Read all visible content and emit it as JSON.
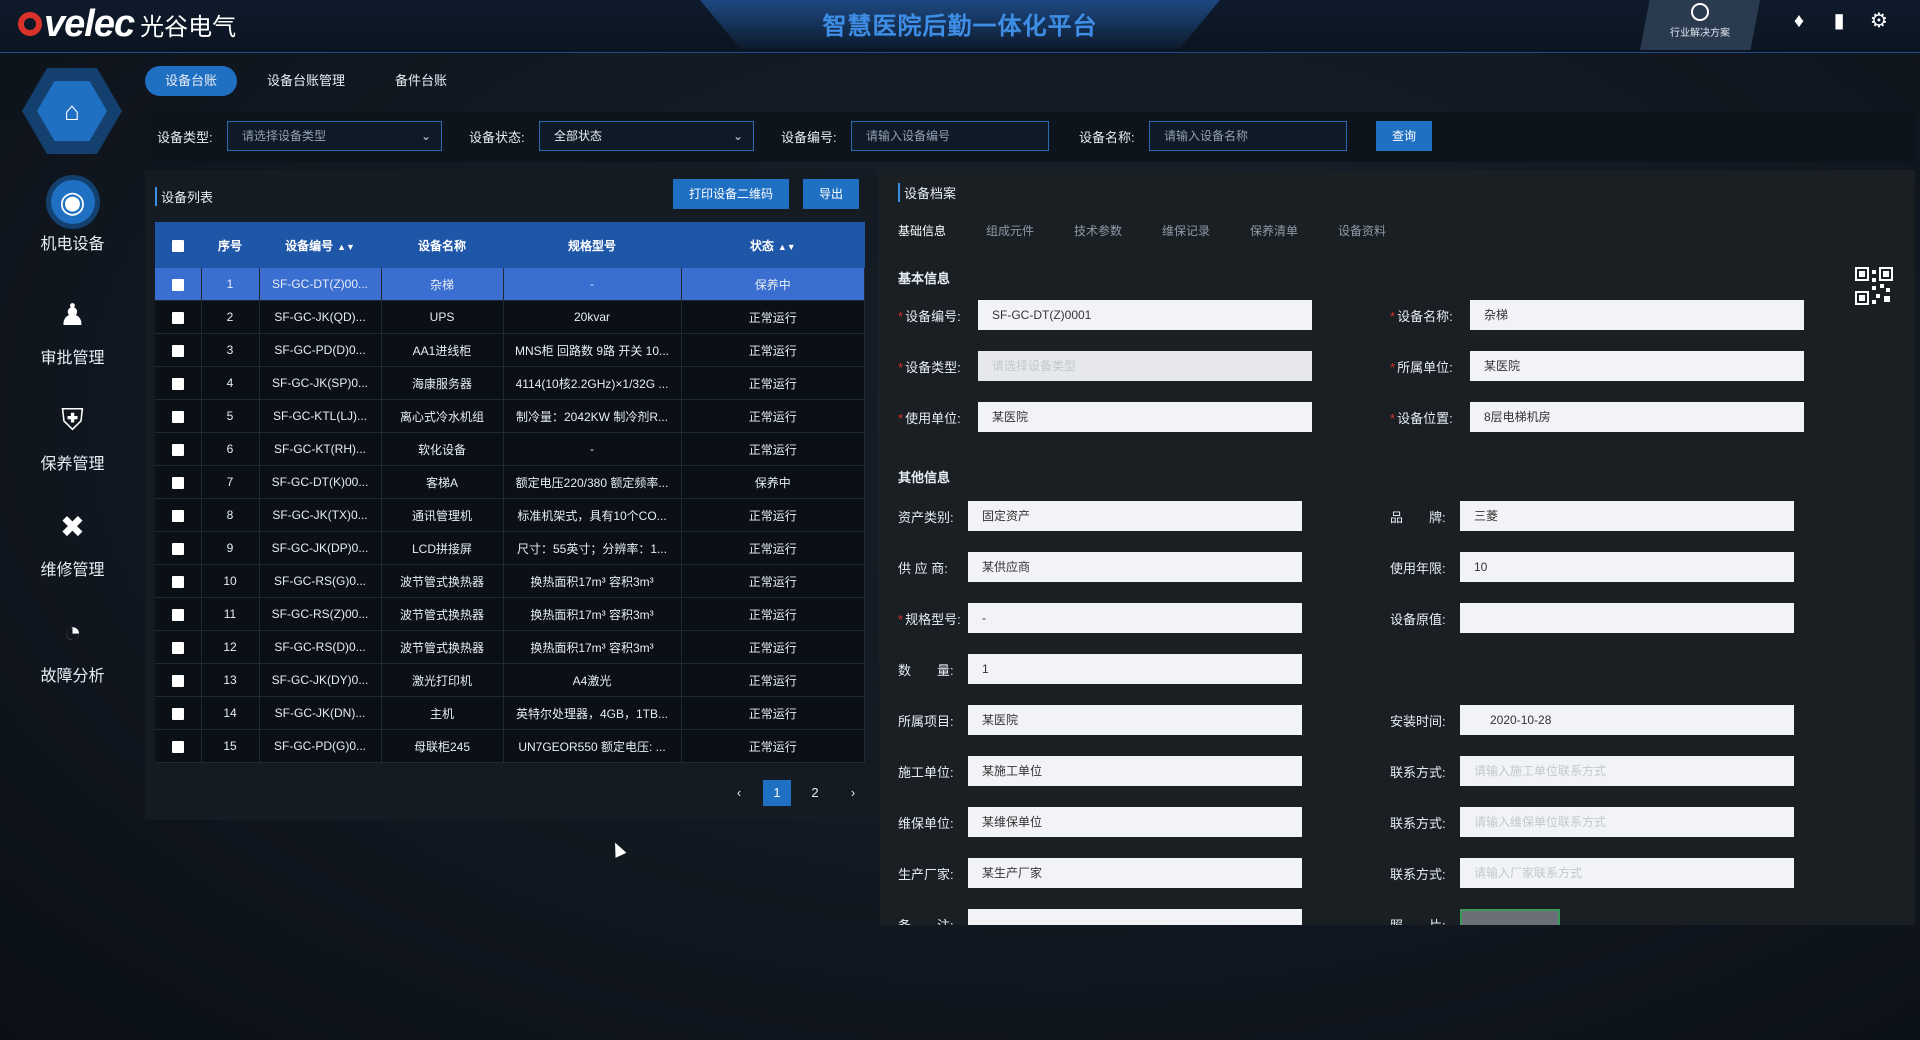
{
  "header": {
    "logo_text": "velec",
    "logo_cn": "光谷电气",
    "title": "智慧医院后勤一体化平台",
    "solution_label": "行业解决方案"
  },
  "icons": {
    "bell": "bell-icon",
    "clipboard": "clipboard-icon",
    "settings": "gear-icon"
  },
  "sidebar": {
    "items": [
      {
        "label": "机电设备",
        "icon": "device-icon"
      },
      {
        "label": "审批管理",
        "icon": "person-stamp-icon"
      },
      {
        "label": "保养管理",
        "icon": "shield-icon"
      },
      {
        "label": "维修管理",
        "icon": "tools-icon"
      },
      {
        "label": "故障分析",
        "icon": "pie-chart-icon"
      }
    ]
  },
  "subtabs": [
    "设备台账",
    "设备台账管理",
    "备件台账"
  ],
  "filters": {
    "type_label": "设备类型:",
    "type_placeholder": "请选择设备类型",
    "status_label": "设备状态:",
    "status_value": "全部状态",
    "code_label": "设备编号:",
    "code_placeholder": "请输入设备编号",
    "name_label": "设备名称:",
    "name_placeholder": "请输入设备名称",
    "query_button": "查询"
  },
  "list": {
    "title": "设备列表",
    "print_button": "打印设备二维码",
    "export_button": "导出",
    "columns": [
      "序号",
      "设备编号",
      "设备名称",
      "规格型号",
      "状态"
    ],
    "rows": [
      [
        "1",
        "SF-GC-DT(Z)00...",
        "杂梯",
        "-",
        "保养中"
      ],
      [
        "2",
        "SF-GC-JK(QD)...",
        "UPS",
        "20kvar",
        "正常运行"
      ],
      [
        "3",
        "SF-GC-PD(D)0...",
        "AA1进线柜",
        "MNS柜 回路数 9路 开关 10...",
        "正常运行"
      ],
      [
        "4",
        "SF-GC-JK(SP)0...",
        "海康服务器",
        "4114(10核2.2GHz)×1/32G ...",
        "正常运行"
      ],
      [
        "5",
        "SF-GC-KTL(LJ)...",
        "离心式冷水机组",
        "制冷量：2042KW 制冷剂R...",
        "正常运行"
      ],
      [
        "6",
        "SF-GC-KT(RH)...",
        "软化设备",
        "-",
        "正常运行"
      ],
      [
        "7",
        "SF-GC-DT(K)00...",
        "客梯A",
        "额定电压220/380 额定频率...",
        "保养中"
      ],
      [
        "8",
        "SF-GC-JK(TX)0...",
        "通讯管理机",
        "标准机架式，具有10个CO...",
        "正常运行"
      ],
      [
        "9",
        "SF-GC-JK(DP)0...",
        "LCD拼接屏",
        "尺寸：55英寸；分辨率：1...",
        "正常运行"
      ],
      [
        "10",
        "SF-GC-RS(G)0...",
        "波节管式换热器",
        "换热面积17m³ 容积3m³",
        "正常运行"
      ],
      [
        "11",
        "SF-GC-RS(Z)00...",
        "波节管式换热器",
        "换热面积17m³ 容积3m³",
        "正常运行"
      ],
      [
        "12",
        "SF-GC-RS(D)0...",
        "波节管式换热器",
        "换热面积17m³ 容积3m³",
        "正常运行"
      ],
      [
        "13",
        "SF-GC-JK(DY)0...",
        "激光打印机",
        "A4激光",
        "正常运行"
      ],
      [
        "14",
        "SF-GC-JK(DN)...",
        "主机",
        "英特尔处理器，4GB，1TB...",
        "正常运行"
      ],
      [
        "15",
        "SF-GC-PD(G)0...",
        "母联柜245",
        "UN7GEOR550 额定电压: ...",
        "正常运行"
      ]
    ],
    "selected_row": 0,
    "pager": {
      "prev": "‹",
      "pages": [
        "1",
        "2"
      ],
      "current": "1",
      "next": "›"
    }
  },
  "detail": {
    "title": "设备档案",
    "tabs": [
      "基础信息",
      "组成元件",
      "技术参数",
      "维保记录",
      "保养清单",
      "设备资料"
    ],
    "basic_title": "基本信息",
    "other_title": "其他信息",
    "basic": {
      "code_label": "设备编号:",
      "code_value": "SF-GC-DT(Z)0001",
      "name_label": "设备名称:",
      "name_value": "杂梯",
      "type_label": "设备类型:",
      "type_value": "请选择设备类型",
      "dept_label": "所属单位:",
      "dept_value": "某医院",
      "user_label": "使用单位:",
      "user_value": "某医院",
      "loc_label": "设备位置:",
      "loc_value": "8层电梯机房"
    },
    "other": {
      "asset_label": "资产类别:",
      "asset_value": "固定资产",
      "brand_label": "品　　牌:",
      "brand_value": "三菱",
      "supplier_label": "供 应 商:",
      "supplier_value": "某供应商",
      "years_label": "使用年限:",
      "years_value": "10",
      "spec_label": "规格型号:",
      "spec_value": "-",
      "price_label": "设备原值:",
      "price_value": "",
      "qty_label": "数　　量:",
      "qty_value": "1",
      "project_label": "所属项目:",
      "project_value": "某医院",
      "install_label": "安装时间:",
      "install_value": "2020-10-28",
      "builder_label": "施工单位:",
      "builder_value": "某施工单位",
      "contact1_label": "联系方式:",
      "contact1_value": "请输入施工单位联系方式",
      "maint_label": "维保单位:",
      "maint_value": "某维保单位",
      "contact2_label": "联系方式:",
      "contact2_value": "请输入维保单位联系方式",
      "maker_label": "生产厂家:",
      "maker_value": "某生产厂家",
      "contact3_label": "联系方式:",
      "contact3_value": "请输入厂家联系方式",
      "remark_label": "备　　注:",
      "photo_label": "照　　片:"
    }
  },
  "colors": {
    "accent": "#1f6fc2",
    "header_row": "#1e56a8",
    "selected_row": "#3a6ed0",
    "required": "#d9322b"
  }
}
